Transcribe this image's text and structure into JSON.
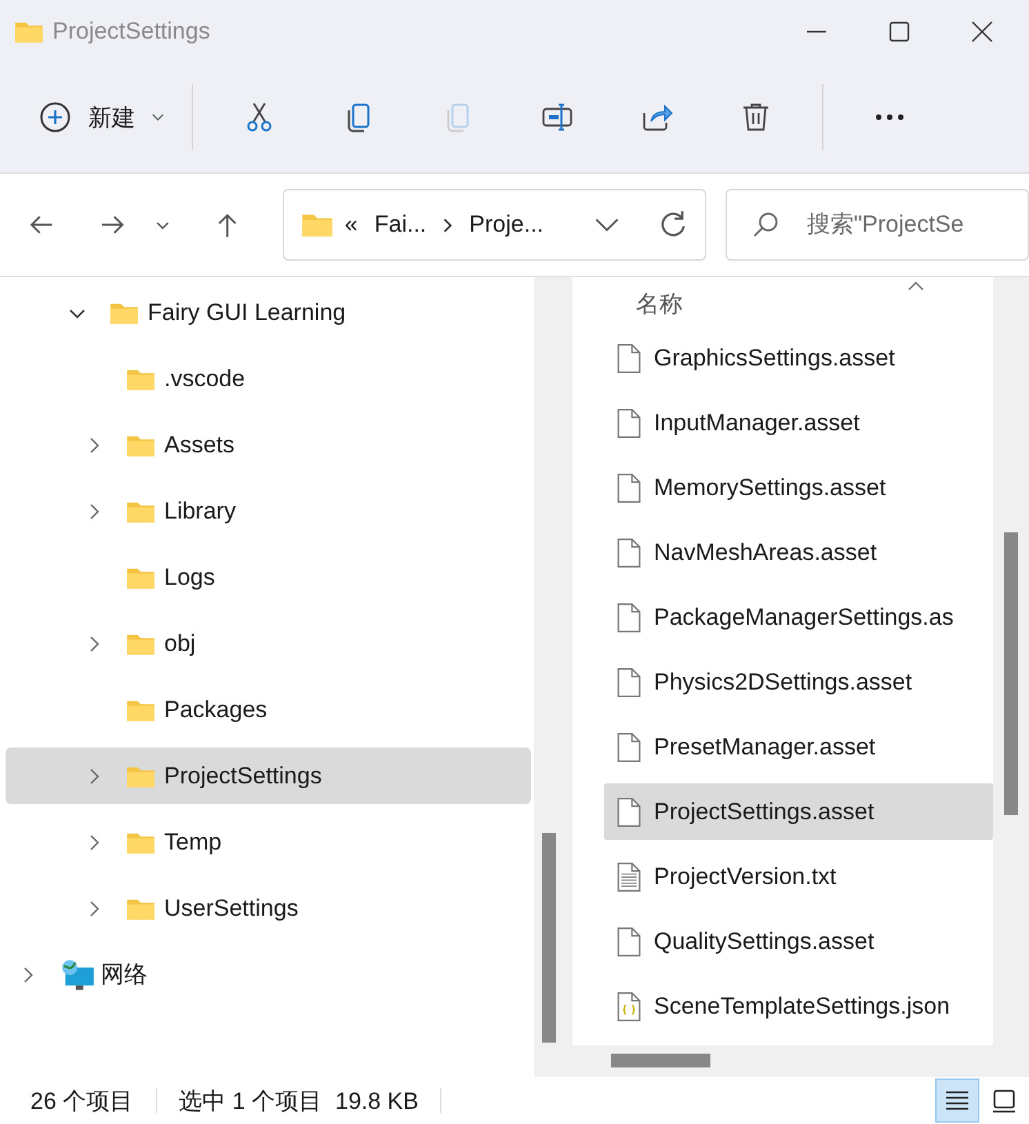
{
  "window": {
    "title": "ProjectSettings"
  },
  "toolbar": {
    "new_button": {
      "label": "新建"
    },
    "tools": [
      {
        "kind": "cut",
        "disabled": false
      },
      {
        "kind": "copy",
        "disabled": false
      },
      {
        "kind": "paste",
        "disabled": true
      },
      {
        "kind": "rename",
        "disabled": false
      },
      {
        "kind": "share",
        "disabled": false
      },
      {
        "kind": "delete",
        "disabled": false
      },
      {
        "kind": "more",
        "disabled": false
      }
    ]
  },
  "address_bar": {
    "overflow": "«",
    "crumbs": [
      "Fai...",
      "Proje..."
    ]
  },
  "search": {
    "placeholder": "搜索\"ProjectSe"
  },
  "tree": [
    {
      "kind": "folder",
      "label": "Fairy GUI Learning",
      "expandable": true,
      "expanded": true,
      "selected": false,
      "children": [
        {
          "kind": "folder",
          "label": ".vscode",
          "expandable": false,
          "selected": false
        },
        {
          "kind": "folder",
          "label": "Assets",
          "expandable": true,
          "expanded": false,
          "selected": false
        },
        {
          "kind": "folder",
          "label": "Library",
          "expandable": true,
          "expanded": false,
          "selected": false
        },
        {
          "kind": "folder",
          "label": "Logs",
          "expandable": false,
          "selected": false
        },
        {
          "kind": "folder",
          "label": "obj",
          "expandable": true,
          "expanded": false,
          "selected": false
        },
        {
          "kind": "folder",
          "label": "Packages",
          "expandable": false,
          "selected": false
        },
        {
          "kind": "folder",
          "label": "ProjectSettings",
          "expandable": true,
          "expanded": false,
          "selected": true
        },
        {
          "kind": "folder",
          "label": "Temp",
          "expandable": true,
          "expanded": false,
          "selected": false
        },
        {
          "kind": "folder",
          "label": "UserSettings",
          "expandable": true,
          "expanded": false,
          "selected": false
        }
      ]
    },
    {
      "kind": "network",
      "label": "网络",
      "expandable": true,
      "expanded": false,
      "selected": false
    }
  ],
  "file_list": {
    "column_header": "名称",
    "files": [
      {
        "kind": "asset",
        "name": "GraphicsSettings.asset",
        "selected": false
      },
      {
        "kind": "asset",
        "name": "InputManager.asset",
        "selected": false
      },
      {
        "kind": "asset",
        "name": "MemorySettings.asset",
        "selected": false
      },
      {
        "kind": "asset",
        "name": "NavMeshAreas.asset",
        "selected": false
      },
      {
        "kind": "asset",
        "name": "PackageManagerSettings.as",
        "selected": false
      },
      {
        "kind": "asset",
        "name": "Physics2DSettings.asset",
        "selected": false
      },
      {
        "kind": "asset",
        "name": "PresetManager.asset",
        "selected": false
      },
      {
        "kind": "asset",
        "name": "ProjectSettings.asset",
        "selected": true
      },
      {
        "kind": "text",
        "name": "ProjectVersion.txt",
        "selected": false
      },
      {
        "kind": "asset",
        "name": "QualitySettings.asset",
        "selected": false
      },
      {
        "kind": "json",
        "name": "SceneTemplateSettings.json",
        "selected": false
      }
    ]
  },
  "status_bar": {
    "item_count": "26 个项目",
    "selection": "选中 1 个项目  19.8 KB",
    "views": [
      {
        "kind": "details",
        "selected": true
      },
      {
        "kind": "tiles",
        "selected": false
      }
    ]
  }
}
